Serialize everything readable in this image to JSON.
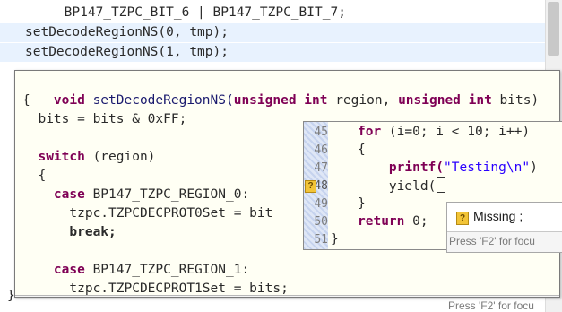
{
  "editor": {
    "lines": [
      {
        "pre": "     BP147_TZPC_BIT_6 | BP147_TZPC_BIT_7;"
      },
      {
        "pre": "setDecodeRegionNS(0, tmp);"
      },
      {
        "pre": "setDecodeRegionNS(1, tmp);"
      }
    ]
  },
  "hover": {
    "sig": {
      "kw1": "void",
      "fn": " setDecodeRegionNS(",
      "kw2": "unsigned int",
      "mid": " region, ",
      "kw3": "unsigned int",
      "tail": " bits)"
    },
    "open_brace": "{",
    "bits_line": "  bits = bits & 0xFF;",
    "switch": {
      "kw": "  switch",
      "rest": " (region)"
    },
    "switch_brace": "  {",
    "case0": {
      "kw": "    case",
      "rest": " BP147_TZPC_REGION_0:"
    },
    "assign0": "      tzpc.TZPCDECPROT0Set = bit",
    "break0": "      break;",
    "case1": {
      "kw": "    case",
      "rest": " BP147_TZPC_REGION_1:"
    },
    "assign1": "      tzpc.TZPCDECPROT1Set = bits;",
    "close_brace": "}",
    "footer": "Press 'F2' for focu"
  },
  "inner": {
    "line_numbers": [
      "45",
      "46",
      "47",
      "48",
      "49",
      "50",
      "51"
    ],
    "warning_glyph": "?",
    "for": {
      "kw": "for",
      "rest": " (i=0; i < 10; i++)"
    },
    "brace_open": "{",
    "printf": {
      "fn": "    printf(",
      "str": "\"Testing\\n\"",
      "rest": ")"
    },
    "yield": {
      "text": "    yield("
    },
    "brace_close": "}",
    "ret": {
      "kw": "return",
      "rest": " 0;"
    },
    "last": "}"
  },
  "tooltip": {
    "icon_glyph": "?",
    "message": "Missing ;",
    "footer": "Press 'F2' for focu"
  },
  "colors": {
    "keyword": "#7f0055",
    "string": "#2a00ff",
    "highlight": "#e8f2fe",
    "hover_bg": "#fffff4",
    "warning": "#f2c437"
  }
}
